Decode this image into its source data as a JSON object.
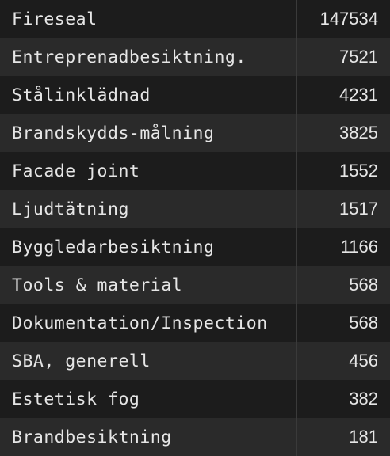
{
  "rows": [
    {
      "name": "Fireseal",
      "count": "147534"
    },
    {
      "name": "Entreprenadbesiktning.",
      "count": "7521"
    },
    {
      "name": "Stålinklädnad",
      "count": "4231"
    },
    {
      "name": "Brandskydds-målning",
      "count": "3825"
    },
    {
      "name": "Facade joint",
      "count": "1552"
    },
    {
      "name": "Ljudtätning",
      "count": "1517"
    },
    {
      "name": "Byggledarbesiktning",
      "count": "1166"
    },
    {
      "name": "Tools & material",
      "count": "568"
    },
    {
      "name": "Dokumentation/Inspection",
      "count": "568"
    },
    {
      "name": "SBA, generell",
      "count": "456"
    },
    {
      "name": "Estetisk fog",
      "count": "382"
    },
    {
      "name": "Brandbesiktning",
      "count": "181"
    }
  ]
}
